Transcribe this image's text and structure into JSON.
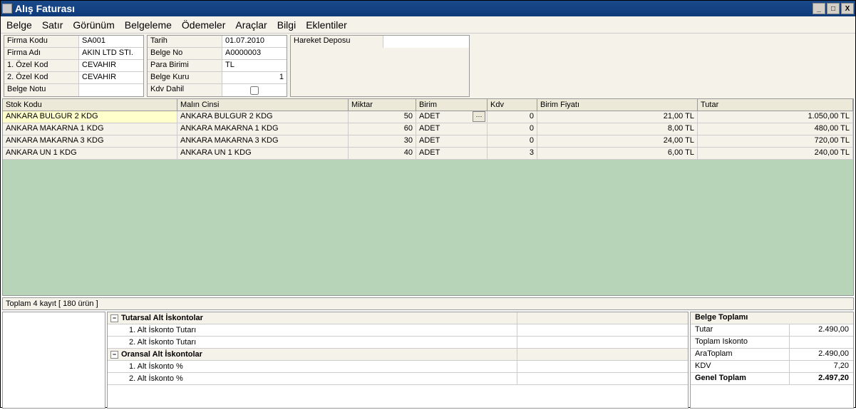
{
  "window": {
    "title": "Alış Faturası"
  },
  "menu": [
    "Belge",
    "Satır",
    "Görünüm",
    "Belgeleme",
    "Ödemeler",
    "Araçlar",
    "Bilgi",
    "Eklentiler"
  ],
  "fields1": [
    {
      "label": "Firma Kodu",
      "value": "SA001"
    },
    {
      "label": "Firma Adı",
      "value": "AKIN LTD STI."
    },
    {
      "label": "1. Özel Kod",
      "value": "CEVAHIR"
    },
    {
      "label": "2. Özel Kod",
      "value": "CEVAHIR"
    },
    {
      "label": "Belge Notu",
      "value": ""
    }
  ],
  "fields2": [
    {
      "label": "Tarih",
      "value": "01.07.2010"
    },
    {
      "label": "Belge No",
      "value": "A0000003"
    },
    {
      "label": "Para Birimi",
      "value": "TL"
    },
    {
      "label": "Belge Kuru",
      "value": "1",
      "right": true
    },
    {
      "label": "Kdv Dahil",
      "checkbox": true
    }
  ],
  "fields3": [
    {
      "label": "Hareket Deposu",
      "value": ""
    }
  ],
  "grid": {
    "headers": {
      "stok": "Stok Kodu",
      "malin": "Malın Cinsi",
      "miktar": "Miktar",
      "birim": "Birim",
      "kdv": "Kdv",
      "fiyat": "Birim Fiyatı",
      "tutar": "Tutar"
    },
    "rows": [
      {
        "stok": "ANKARA BULGUR 2 KDG",
        "malin": "ANKARA BULGUR 2 KDG",
        "miktar": "50",
        "birim": "ADET",
        "birimBtn": true,
        "kdv": "0",
        "fiyat": "21,00 TL",
        "tutar": "1.050,00 TL",
        "sel": true
      },
      {
        "stok": "ANKARA MAKARNA 1 KDG",
        "malin": "ANKARA MAKARNA 1 KDG",
        "miktar": "60",
        "birim": "ADET",
        "kdv": "0",
        "fiyat": "8,00 TL",
        "tutar": "480,00 TL"
      },
      {
        "stok": "ANKARA MAKARNA 3 KDG",
        "malin": "ANKARA MAKARNA 3 KDG",
        "miktar": "30",
        "birim": "ADET",
        "kdv": "0",
        "fiyat": "24,00 TL",
        "tutar": "720,00 TL"
      },
      {
        "stok": "ANKARA UN 1 KDG",
        "malin": "ANKARA UN 1 KDG",
        "miktar": "40",
        "birim": "ADET",
        "kdv": "3",
        "fiyat": "6,00 TL",
        "tutar": "240,00 TL"
      }
    ]
  },
  "status": "Toplam 4 kayıt [ 180 ürün ]",
  "discounts": {
    "h1": "Tutarsal Alt İskontolar",
    "r1": "1. Alt İskonto Tutarı",
    "r2": "2. Alt İskonto Tutarı",
    "h2": "Oransal Alt İskontolar",
    "r3": "1. Alt İskonto %",
    "r4": "2. Alt İskonto %"
  },
  "totals": {
    "header": "Belge Toplamı",
    "rows": [
      {
        "label": "Tutar",
        "value": "2.490,00"
      },
      {
        "label": "Toplam Iskonto",
        "value": ""
      },
      {
        "label": "AraToplam",
        "value": "2.490,00"
      },
      {
        "label": "KDV",
        "value": "7,20"
      },
      {
        "label": "Genel Toplam",
        "value": "2.497,20",
        "bold": true
      }
    ]
  }
}
